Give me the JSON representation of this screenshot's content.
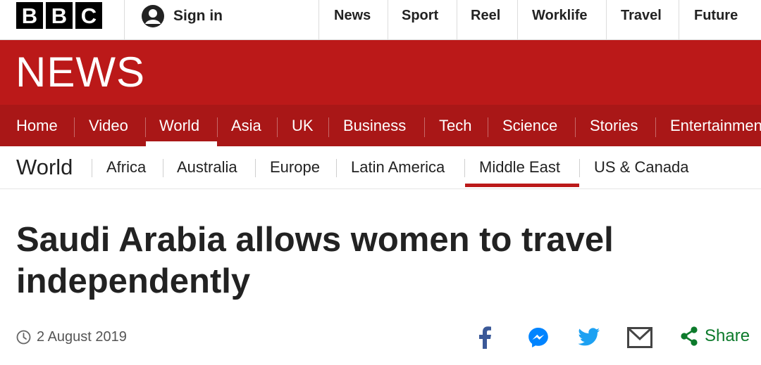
{
  "brand": {
    "logo_letters": [
      "B",
      "B",
      "C"
    ],
    "news_wordmark": "NEWS",
    "colors": {
      "red": "#bb1919",
      "nav_red": "#a91717",
      "share_green": "#0c7a2b",
      "facebook": "#3b5998",
      "messenger": "#0084ff",
      "twitter": "#1da1f2"
    }
  },
  "topbar": {
    "signin_icon": "user-icon",
    "signin_label": "Sign in",
    "links": [
      "News",
      "Sport",
      "Reel",
      "Worklife",
      "Travel",
      "Future"
    ]
  },
  "main_nav": {
    "items": [
      "Home",
      "Video",
      "World",
      "Asia",
      "UK",
      "Business",
      "Tech",
      "Science",
      "Stories",
      "Entertainment & Arts"
    ],
    "active": "World"
  },
  "sub_nav": {
    "title": "World",
    "items": [
      "Africa",
      "Australia",
      "Europe",
      "Latin America",
      "Middle East",
      "US & Canada"
    ],
    "active": "Middle East"
  },
  "article": {
    "headline": "Saudi Arabia allows women to travel independently",
    "date": "2 August 2019"
  },
  "share": {
    "icons": [
      "facebook-icon",
      "messenger-icon",
      "twitter-icon",
      "email-icon",
      "share-icon"
    ],
    "label": "Share"
  }
}
